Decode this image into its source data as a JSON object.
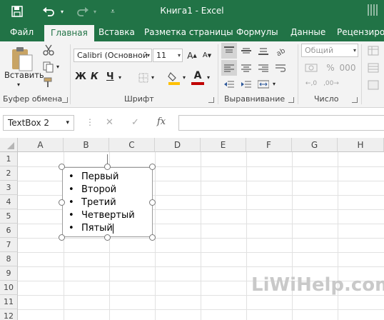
{
  "window": {
    "title": "Книга1 - Excel"
  },
  "tabs": [
    {
      "label": "Файл"
    },
    {
      "label": "Главная"
    },
    {
      "label": "Вставка"
    },
    {
      "label": "Разметка страницы"
    },
    {
      "label": "Формулы"
    },
    {
      "label": "Данные"
    },
    {
      "label": "Рецензиров"
    }
  ],
  "ribbon": {
    "clipboard": {
      "paste_label": "Вставить",
      "group_label": "Буфер обмена"
    },
    "font": {
      "font_name": "Calibri (Основной",
      "font_size": "11",
      "bold": "Ж",
      "italic": "К",
      "underline": "Ч",
      "font_color_letter": "A",
      "group_label": "Шрифт",
      "font_color": "#c00000",
      "fill_color": "#ffc000"
    },
    "alignment": {
      "group_label": "Выравнивание"
    },
    "number": {
      "format": "Общий",
      "group_label": "Число"
    }
  },
  "formula_bar": {
    "name_box": "TextBox 2",
    "fx": "fx",
    "cancel": "✕",
    "enter": "✓",
    "value": ""
  },
  "grid": {
    "columns": [
      "A",
      "B",
      "C",
      "D",
      "E",
      "F",
      "G",
      "H"
    ],
    "rows": [
      "1",
      "2",
      "3",
      "4",
      "5",
      "6",
      "7",
      "8",
      "9",
      "10",
      "11",
      "12"
    ]
  },
  "textbox": {
    "items": [
      "Первый",
      "Второй",
      "Третий",
      "Четвертый",
      "Пятый"
    ],
    "bullet": "•"
  },
  "watermark": "LiWiHelp.com",
  "colors": {
    "accent": "#217346",
    "ribbon_bg": "#f3f3f3"
  }
}
